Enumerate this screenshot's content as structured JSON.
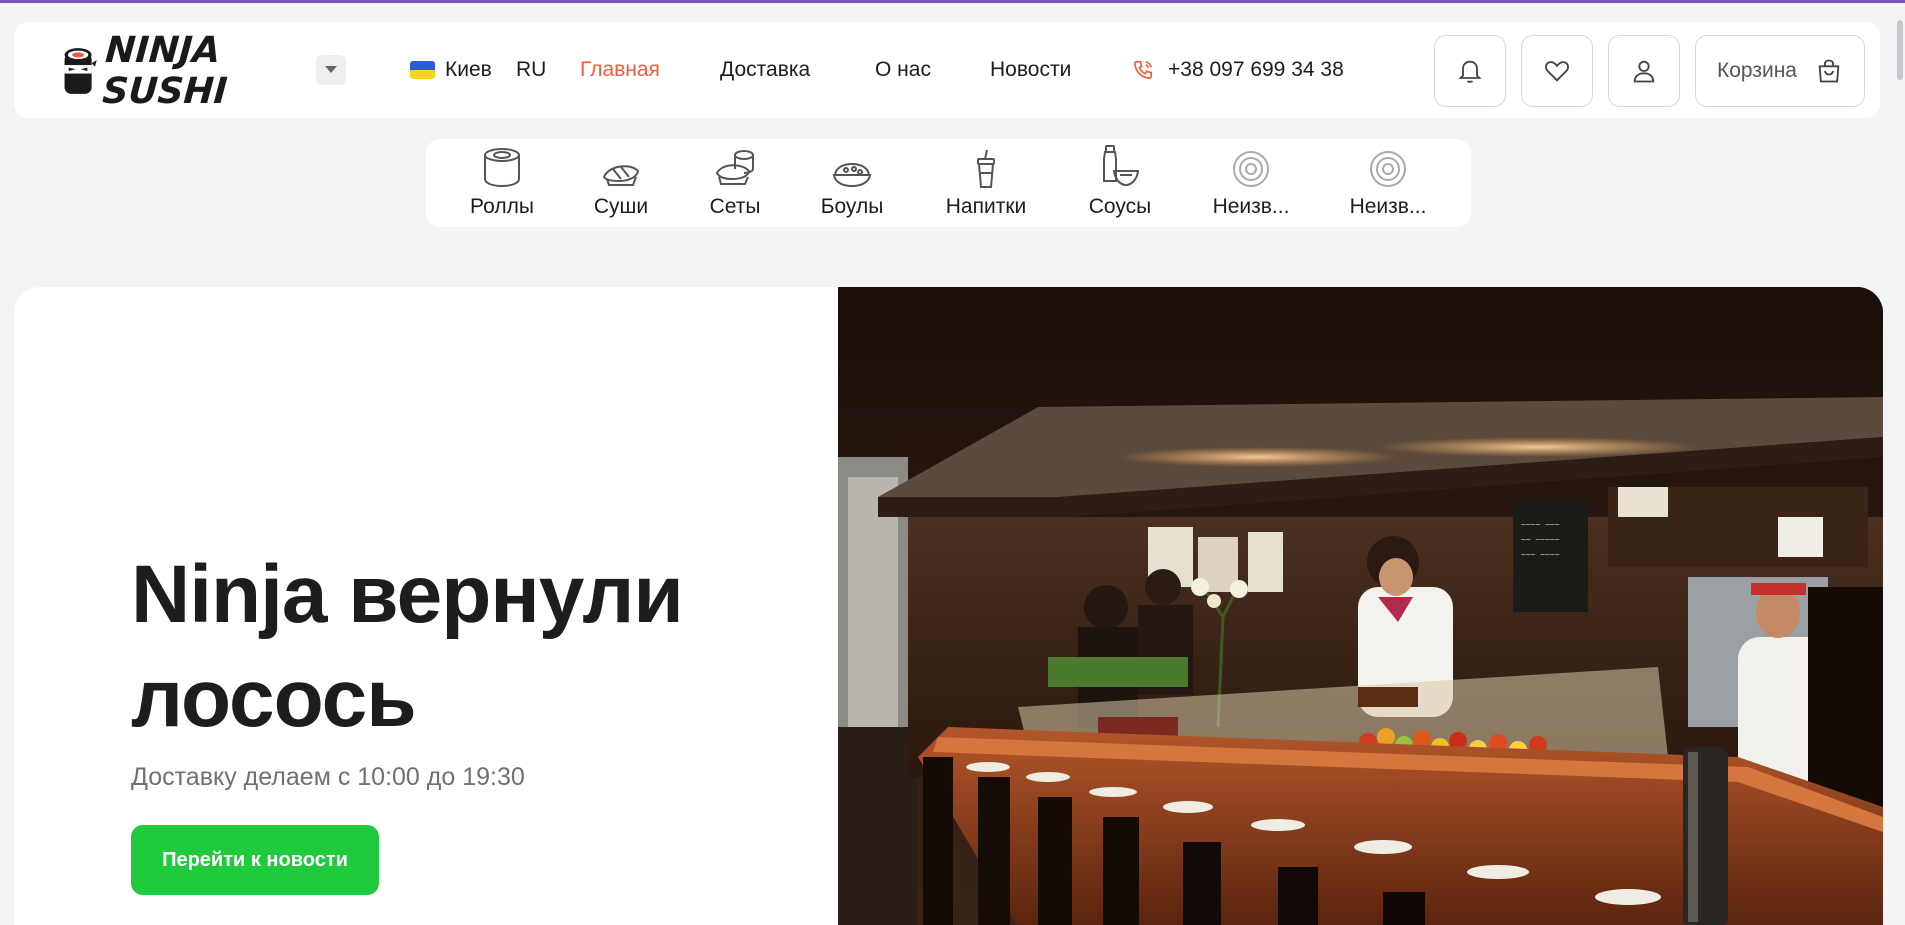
{
  "brand": {
    "logo_text": "NINJA SUSHI"
  },
  "header": {
    "city": "Киев",
    "language": "RU",
    "nav": [
      {
        "label": "Главная",
        "active": true
      },
      {
        "label": "Доставка",
        "active": false
      },
      {
        "label": "О нас",
        "active": false
      },
      {
        "label": "Новости",
        "active": false
      }
    ],
    "phone": "+38 097 699 34 38",
    "cart_label": "Корзина",
    "icons": [
      "bell-icon",
      "heart-icon",
      "user-icon",
      "cart-icon",
      "phone-icon"
    ]
  },
  "categories": [
    {
      "label": "Роллы",
      "icon": "roll-icon"
    },
    {
      "label": "Суши",
      "icon": "sushi-icon"
    },
    {
      "label": "Сеты",
      "icon": "set-icon"
    },
    {
      "label": "Боулы",
      "icon": "bowl-icon"
    },
    {
      "label": "Напитки",
      "icon": "drink-icon"
    },
    {
      "label": "Соусы",
      "icon": "sauce-icon"
    },
    {
      "label": "Неизв...",
      "icon": "unknown-icon"
    },
    {
      "label": "Неизв...",
      "icon": "unknown-icon"
    }
  ],
  "hero": {
    "title": "Ninja вернули лосось",
    "subtitle": "Доставку делаем с 10:00 до 19:30",
    "button": "Перейти к новости"
  },
  "colors": {
    "accent": "#f25c3a",
    "button_green": "#1fcb3c",
    "topline": "#7b4fb0"
  }
}
